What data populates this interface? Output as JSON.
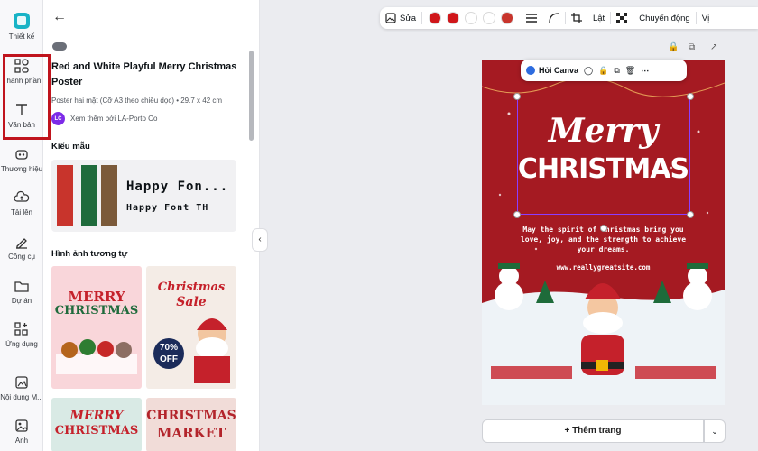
{
  "rail": {
    "items": [
      {
        "label": "Thiết kế",
        "icon": "design-icon"
      },
      {
        "label": "Thành phần",
        "icon": "elements-icon"
      },
      {
        "label": "Văn bản",
        "icon": "text-icon"
      },
      {
        "label": "Thương hiệu",
        "icon": "brand-icon"
      },
      {
        "label": "Tải lên",
        "icon": "upload-icon"
      },
      {
        "label": "Công cụ",
        "icon": "tools-icon"
      },
      {
        "label": "Dự án",
        "icon": "projects-icon"
      },
      {
        "label": "Ứng dụng",
        "icon": "apps-icon"
      },
      {
        "label": "Nội dung M...",
        "icon": "magic-media-icon"
      },
      {
        "label": "Ảnh",
        "icon": "photos-icon"
      }
    ]
  },
  "panel": {
    "title": "Red and White Playful Merry Christmas Poster",
    "subtitle": "Poster hai mặt (Cỡ A3 theo chiều dọc) • 29.7 x 42 cm",
    "author_initials": "LC",
    "author_text": "Xem thêm bởi LA-Porto Co",
    "styles_heading": "Kiểu mẫu",
    "font_sample_1": "Happy Fon...",
    "font_sample_2": "Happy Font TH",
    "similar_heading": "Hình ảnh tương tự",
    "thumbs": [
      {
        "line1": "MERRY",
        "line2": "CHRISTMAS"
      },
      {
        "line1": "Christmas",
        "line2": "Sale",
        "badge": "70% OFF"
      },
      {
        "line1": "MERRY",
        "line2": "CHRISTMAS"
      },
      {
        "line1": "CHRISTMAS",
        "line2": "MARKET"
      }
    ],
    "swatch_colors": [
      "#c8342c",
      "#1f6b3c",
      "#7b5a3a"
    ]
  },
  "toolbar": {
    "edit_label": "Sửa",
    "flip_label": "Lật",
    "animate_label": "Chuyển động",
    "position_label": "Vị",
    "colors": [
      "#d0161a",
      "#d0161a",
      "#ffffff",
      "#ffffff",
      "#c8342c"
    ]
  },
  "canvas": {
    "context_menu_label": "Hỏi Canva",
    "poster_title_1": "Merry",
    "poster_title_2": "CHRISTMAS",
    "poster_body": "May the spirit of Christmas bring you love, joy, and the strength to achieve your dreams.",
    "poster_url": "www.reallygreatsite.com",
    "add_page_label": "+ Thêm trang"
  }
}
